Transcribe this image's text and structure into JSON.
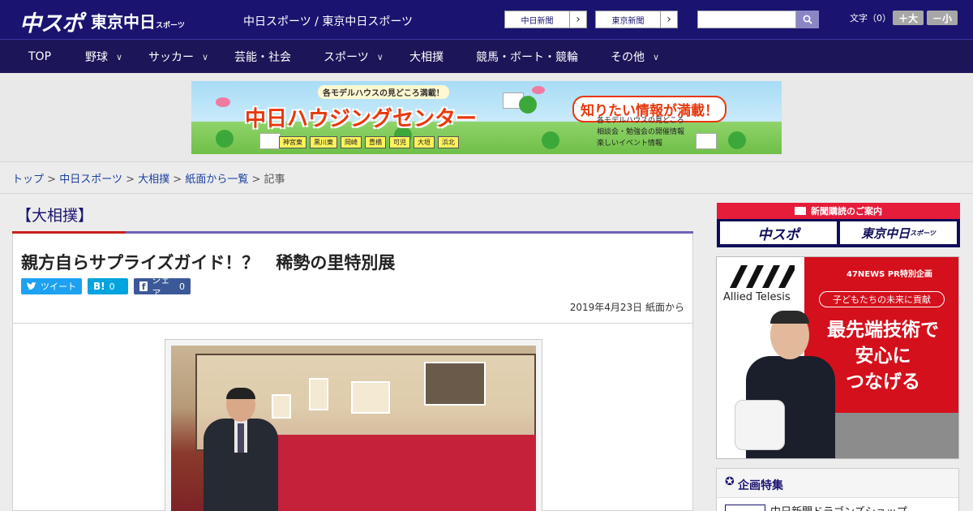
{
  "header": {
    "logo_primary": "中スポ",
    "logo_secondary": "東京中日",
    "logo_secondary_small": "スポーツ",
    "site_title": "中日スポーツ / 東京中日スポーツ",
    "paper_links": [
      "中日新聞",
      "東京新聞"
    ],
    "search_placeholder": "",
    "font_size_label": "文字（0）",
    "font_larger": "＋大",
    "font_smaller": "－小"
  },
  "nav": {
    "items": [
      {
        "label": "TOP",
        "has_dropdown": false
      },
      {
        "label": "野球",
        "has_dropdown": true
      },
      {
        "label": "サッカー",
        "has_dropdown": true
      },
      {
        "label": "芸能・社会",
        "has_dropdown": false
      },
      {
        "label": "スポーツ",
        "has_dropdown": true
      },
      {
        "label": "大相撲",
        "has_dropdown": false
      },
      {
        "label": "競馬・ボート・競輪",
        "has_dropdown": false
      },
      {
        "label": "その他",
        "has_dropdown": true
      }
    ]
  },
  "banner": {
    "top_text": "各モデルハウスの見どころ満載！",
    "title": "中日ハウジングセンター",
    "right_title": "知りたい情報が満載！",
    "features": [
      "各モデルハウスの見どころ",
      "相談会・勉強会の開催情報",
      "楽しいイベント情報"
    ],
    "cities": [
      "神宮東",
      "黒川東",
      "岡崎",
      "豊橋",
      "可児",
      "大垣",
      "浜北"
    ]
  },
  "breadcrumb": {
    "items": [
      "トップ",
      "中日スポーツ",
      "大相撲",
      "紙面から一覧"
    ],
    "current": "記事",
    "separator": ">"
  },
  "article": {
    "category": "【大相撲】",
    "headline": "親方自らサプライズガイド！？　稀勢の里特別展",
    "share": {
      "tweet_label": "ツイート",
      "hatena_label": "B!",
      "hatena_count": "0",
      "facebook_label": "シェア",
      "facebook_count": "0"
    },
    "date": "2019年4月23日",
    "source": "紙面から"
  },
  "sidebar": {
    "subscription": {
      "title": "新聞購読のご案内",
      "logos": [
        "中スポ",
        "東京中日"
      ],
      "logo_small": "スポーツ"
    },
    "ad": {
      "brand": "Allied Telesis",
      "tag": "47NEWS PR特別企画",
      "pill": "子どもたちの未来に貢献",
      "headline_lines": [
        "最先端技術で",
        "安心に",
        "つなげる"
      ]
    },
    "feature": {
      "title": "企画特集",
      "first_item": "中日新聞ドラゴンズショップ"
    }
  },
  "colors": {
    "header_bg": "#1a1470",
    "nav_bg": "#1c1558",
    "accent_purple": "#6e63b7",
    "accent_red": "#c8201c",
    "twitter": "#1da1f2",
    "hatena": "#00a4de",
    "facebook": "#3b5998"
  }
}
